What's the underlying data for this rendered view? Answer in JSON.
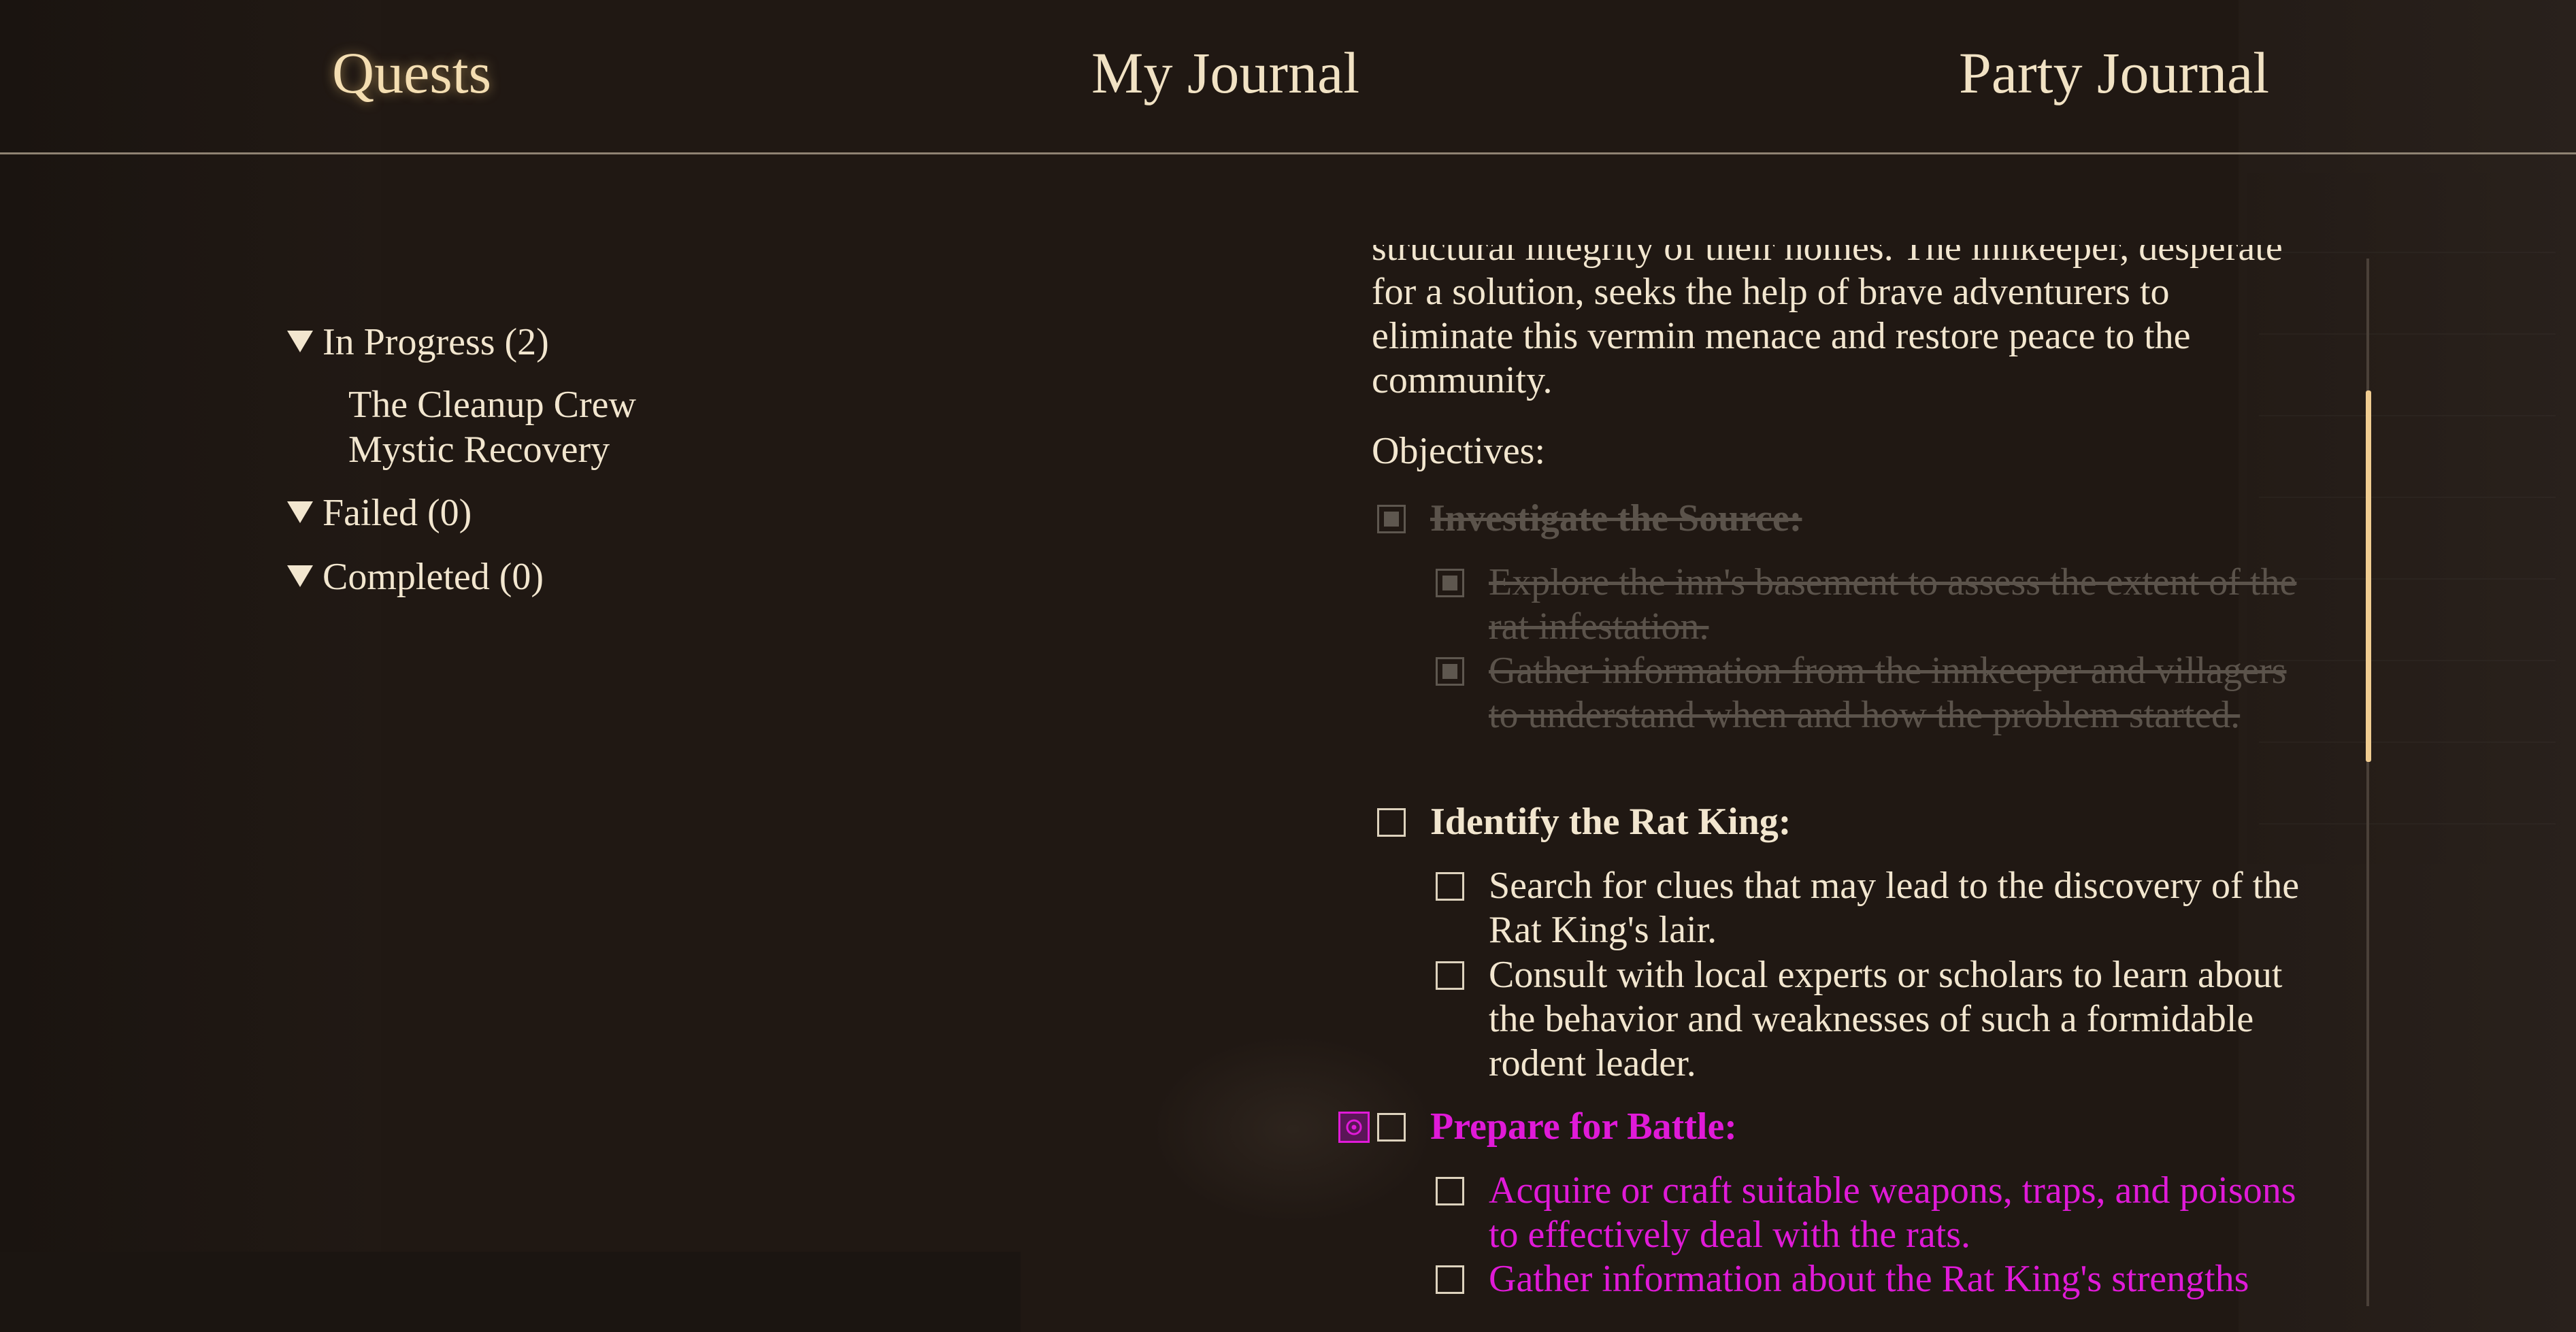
{
  "tabs": [
    {
      "label": "Quests",
      "active": true
    },
    {
      "label": "My Journal",
      "active": false
    },
    {
      "label": "Party Journal",
      "active": false
    }
  ],
  "quest_groups": [
    {
      "label": "In Progress (2)",
      "items": [
        "The Cleanup Crew",
        "Mystic Recovery"
      ]
    },
    {
      "label": "Failed (0)",
      "items": []
    },
    {
      "label": "Completed (0)",
      "items": []
    }
  ],
  "detail": {
    "description_lines": [
      "structural integrity of their homes. The innkeeper, desperate",
      "for a solution, seeks the help of brave adventurers to",
      "eliminate this vermin menace and restore peace to the",
      "community."
    ],
    "objectives_label": "Objectives:",
    "objectives": [
      {
        "title": "Investigate the Source:",
        "state": "completed",
        "subs": [
          {
            "text": "Explore the inn's basement to assess the extent of the rat infestation.",
            "state": "completed"
          },
          {
            "text": "Gather information from the innkeeper and villagers to understand when and how the problem started.",
            "state": "completed"
          }
        ]
      },
      {
        "title": "Identify the Rat King:",
        "state": "open",
        "subs": [
          {
            "text": "Search for clues that may lead to the discovery of the Rat King's lair.",
            "state": "open"
          },
          {
            "text": "Consult with local experts or scholars to learn about the behavior and weaknesses of such a formidable rodent leader.",
            "state": "open"
          }
        ]
      },
      {
        "title": "Prepare for Battle:",
        "state": "tracked",
        "subs": [
          {
            "text": "Acquire or craft suitable weapons, traps, and poisons to effectively deal with the rats.",
            "state": "tracked"
          },
          {
            "text": "Gather information about the Rat King's strengths",
            "state": "tracked"
          }
        ]
      }
    ]
  },
  "colors": {
    "background": "#201813",
    "text": "#f2e6cf",
    "completed": "#5b534b",
    "tracked": "#e01ad8",
    "scroll_thumb": "#f0cc91"
  },
  "icons": {
    "expand": "triangle-down-icon",
    "checkbox": "checkbox-icon",
    "track": "tracked-objective-icon"
  }
}
